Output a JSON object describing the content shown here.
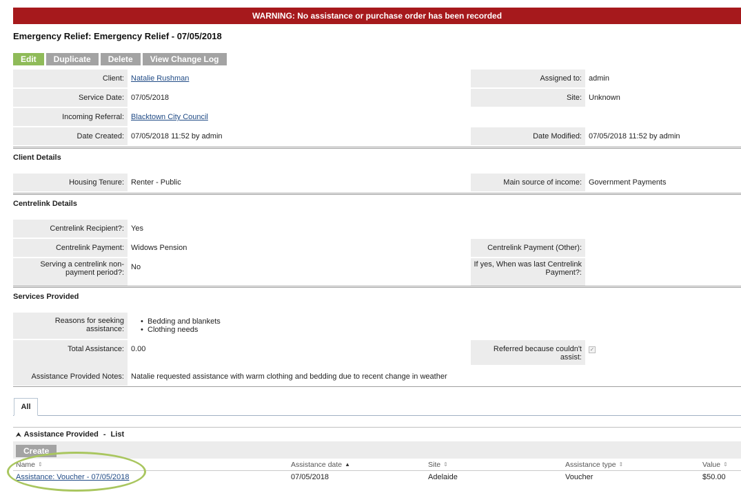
{
  "warning": "WARNING: No assistance or purchase order has been recorded",
  "title": "Emergency Relief: Emergency Relief - 07/05/2018",
  "toolbar": {
    "edit": "Edit",
    "duplicate": "Duplicate",
    "delete": "Delete",
    "view_log": "View Change Log"
  },
  "overview": {
    "client_label": "Client:",
    "client_value": "Natalie Rushman",
    "assigned_label": "Assigned to:",
    "assigned_value": "admin",
    "service_date_label": "Service Date:",
    "service_date_value": "07/05/2018",
    "site_label": "Site:",
    "site_value": "Unknown",
    "referral_label": "Incoming Referral:",
    "referral_value": "Blacktown City Council",
    "created_label": "Date Created:",
    "created_value": "07/05/2018 11:52 by admin",
    "modified_label": "Date Modified:",
    "modified_value": "07/05/2018 11:52 by admin"
  },
  "client_details": {
    "title": "Client Details",
    "housing_label": "Housing Tenure:",
    "housing_value": "Renter - Public",
    "income_label": "Main source of income:",
    "income_value": "Government Payments"
  },
  "centrelink": {
    "title": "Centrelink Details",
    "recipient_label": "Centrelink Recipient?:",
    "recipient_value": "Yes",
    "payment_label": "Centrelink Payment:",
    "payment_value": "Widows Pension",
    "payment_other_label": "Centrelink Payment (Other):",
    "nonpayment_label_1": "Serving a centrelink non-",
    "nonpayment_label_2": "payment period?:",
    "nonpayment_value": "No",
    "last_label_1": "If yes, When was last Centrelink",
    "last_label_2": "Payment?:"
  },
  "services": {
    "title": "Services Provided",
    "reasons_label_1": "Reasons for seeking",
    "reasons_label_2": "assistance:",
    "reasons": [
      "Bedding and blankets",
      "Clothing needs"
    ],
    "total_label": "Total Assistance:",
    "total_value": "0.00",
    "referred_label_1": "Referred because couldn't",
    "referred_label_2": "assist:",
    "notes_label": "Assistance Provided Notes:",
    "notes_value": "Natalie requested assistance with warm clothing and bedding due to recent change in weather"
  },
  "tabs": {
    "all": "All"
  },
  "subpanel": {
    "title": "Assistance Provided",
    "sep": "-",
    "list": "List",
    "create": "Create",
    "columns": [
      "Name",
      "Assistance date",
      "Site",
      "Assistance type",
      "Value"
    ],
    "row": {
      "name": "Assistance: Voucher - 07/05/2018",
      "date": "07/05/2018",
      "site": "Adelaide",
      "type": "Voucher",
      "value": "$50.00"
    }
  },
  "icons": {
    "sort": "sort-arrows-icon",
    "collapse": "chevron-up-icon",
    "check": "checkmark-icon"
  },
  "colors": {
    "warning_bg": "#a6191c",
    "edit_btn": "#8fbb59",
    "button_gray": "#a3a3a3",
    "highlight_ellipse": "#a9c65f",
    "link": "#1f4a85"
  }
}
